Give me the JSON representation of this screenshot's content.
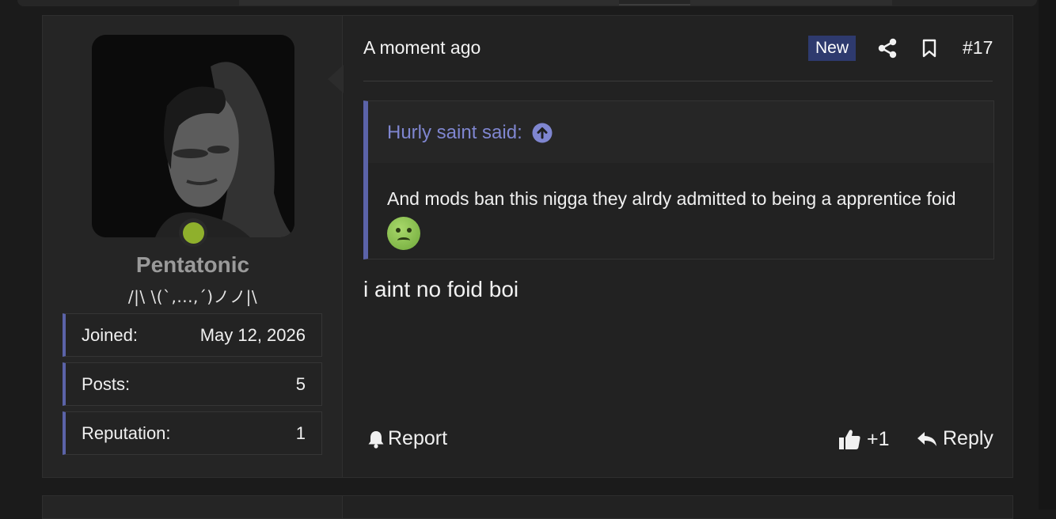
{
  "post": {
    "author": {
      "username": "Pentatonic",
      "user_title": "/|\\ \\(`,...,´)ノノ|\\",
      "online": true,
      "stats": [
        {
          "label": "Joined:",
          "value": "May 12, 2026"
        },
        {
          "label": "Posts:",
          "value": "5"
        },
        {
          "label": "Reputation:",
          "value": "1"
        }
      ]
    },
    "header": {
      "time": "A moment ago",
      "badge": "New",
      "share_icon": "share-icon",
      "bookmark_icon": "bookmark-icon",
      "post_number": "#17"
    },
    "quote": {
      "attribution": "Hurly saint said:",
      "arrow_icon": "arrow-up-circle-icon",
      "text": "And mods ban this nigga they alrdy admitted to being a apprentice foid",
      "emoji": "nauseated-face-emoji"
    },
    "message": "i aint no foid boi",
    "footer": {
      "report_label": "Report",
      "like_count": "+1",
      "reply_label": "Reply"
    }
  },
  "colors": {
    "accent": "#5b63a8",
    "quote_link": "#7f86d0",
    "badge_bg": "#2e3a6e",
    "online": "#8fb02c",
    "background": "#1b1b1b"
  }
}
